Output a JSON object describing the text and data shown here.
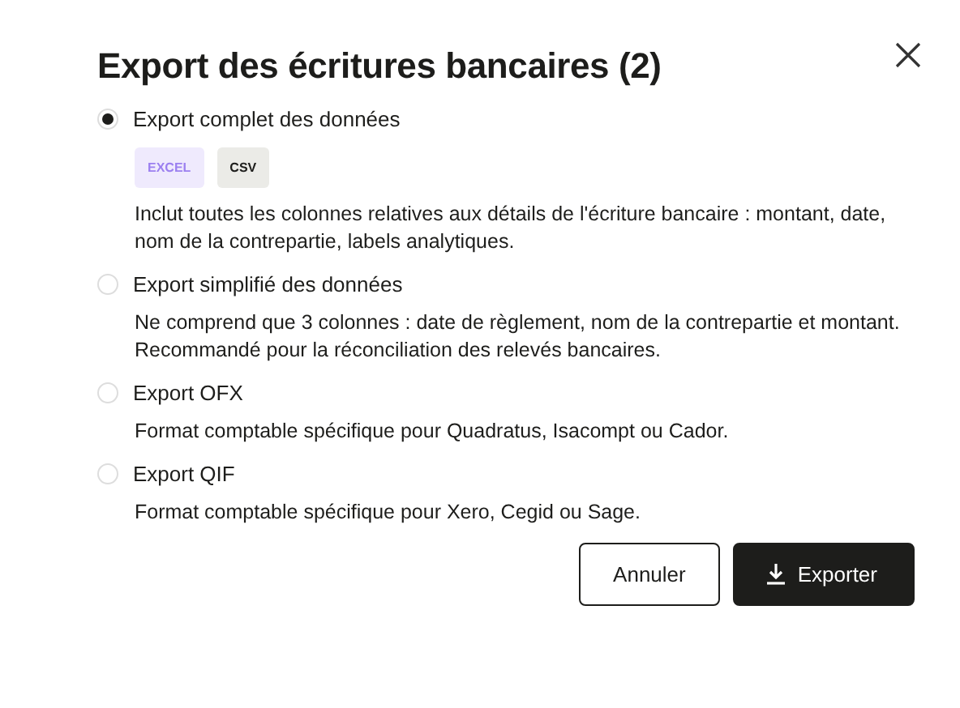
{
  "dialog": {
    "title": "Export des écritures bancaires (2)",
    "options": [
      {
        "label": "Export complet des données",
        "selected": true,
        "formats": [
          {
            "label": "EXCEL",
            "selected": true
          },
          {
            "label": "CSV",
            "selected": false
          }
        ],
        "description": "Inclut toutes les colonnes relatives aux détails de l'écriture bancaire : montant, date, nom de la contrepartie, labels analytiques."
      },
      {
        "label": "Export simplifié des données",
        "selected": false,
        "description": "Ne comprend que 3 colonnes : date de règlement, nom de la contrepartie et montant. Recommandé pour la réconciliation des relevés bancaires."
      },
      {
        "label": "Export OFX",
        "selected": false,
        "description": "Format comptable spécifique pour Quadratus, Isacompt ou Cador."
      },
      {
        "label": "Export QIF",
        "selected": false,
        "description": "Format comptable spécifique pour Xero, Cegid ou Sage."
      }
    ],
    "buttons": [
      {
        "label": "Annuler",
        "kind": "secondary"
      },
      {
        "label": "Exporter",
        "kind": "primary"
      }
    ]
  }
}
